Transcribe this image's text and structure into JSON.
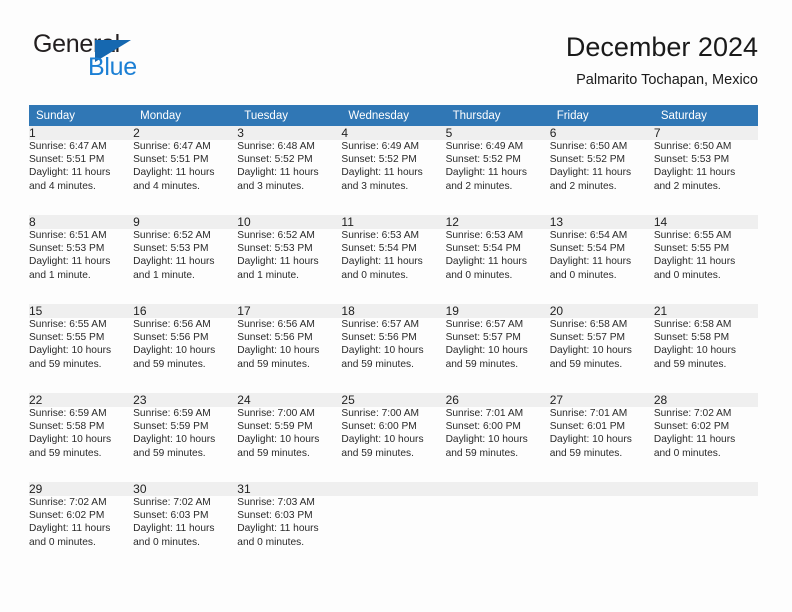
{
  "logo": {
    "word_dark": "General",
    "word_blue": "Blue",
    "triangle_color": "#1668b0",
    "blue_color": "#1b7fd4"
  },
  "header": {
    "title": "December 2024",
    "subtitle": "Palmarito Tochapan, Mexico"
  },
  "theme": {
    "header_blue": "#3077b5",
    "separator_blue": "#1a6cae",
    "daynum_bg": "#efefef",
    "page_bg": "#fdfdfd"
  },
  "calendar": {
    "weekday_headers": [
      "Sunday",
      "Monday",
      "Tuesday",
      "Wednesday",
      "Thursday",
      "Friday",
      "Saturday"
    ],
    "labels": {
      "sunrise": "Sunrise:",
      "sunset": "Sunset:",
      "daylight": "Daylight:"
    },
    "weeks": [
      [
        {
          "day": "1",
          "sunrise": "Sunrise: 6:47 AM",
          "sunset": "Sunset: 5:51 PM",
          "daylight_1": "Daylight: 11 hours",
          "daylight_2": "and 4 minutes."
        },
        {
          "day": "2",
          "sunrise": "Sunrise: 6:47 AM",
          "sunset": "Sunset: 5:51 PM",
          "daylight_1": "Daylight: 11 hours",
          "daylight_2": "and 4 minutes."
        },
        {
          "day": "3",
          "sunrise": "Sunrise: 6:48 AM",
          "sunset": "Sunset: 5:52 PM",
          "daylight_1": "Daylight: 11 hours",
          "daylight_2": "and 3 minutes."
        },
        {
          "day": "4",
          "sunrise": "Sunrise: 6:49 AM",
          "sunset": "Sunset: 5:52 PM",
          "daylight_1": "Daylight: 11 hours",
          "daylight_2": "and 3 minutes."
        },
        {
          "day": "5",
          "sunrise": "Sunrise: 6:49 AM",
          "sunset": "Sunset: 5:52 PM",
          "daylight_1": "Daylight: 11 hours",
          "daylight_2": "and 2 minutes."
        },
        {
          "day": "6",
          "sunrise": "Sunrise: 6:50 AM",
          "sunset": "Sunset: 5:52 PM",
          "daylight_1": "Daylight: 11 hours",
          "daylight_2": "and 2 minutes."
        },
        {
          "day": "7",
          "sunrise": "Sunrise: 6:50 AM",
          "sunset": "Sunset: 5:53 PM",
          "daylight_1": "Daylight: 11 hours",
          "daylight_2": "and 2 minutes."
        }
      ],
      [
        {
          "day": "8",
          "sunrise": "Sunrise: 6:51 AM",
          "sunset": "Sunset: 5:53 PM",
          "daylight_1": "Daylight: 11 hours",
          "daylight_2": "and 1 minute."
        },
        {
          "day": "9",
          "sunrise": "Sunrise: 6:52 AM",
          "sunset": "Sunset: 5:53 PM",
          "daylight_1": "Daylight: 11 hours",
          "daylight_2": "and 1 minute."
        },
        {
          "day": "10",
          "sunrise": "Sunrise: 6:52 AM",
          "sunset": "Sunset: 5:53 PM",
          "daylight_1": "Daylight: 11 hours",
          "daylight_2": "and 1 minute."
        },
        {
          "day": "11",
          "sunrise": "Sunrise: 6:53 AM",
          "sunset": "Sunset: 5:54 PM",
          "daylight_1": "Daylight: 11 hours",
          "daylight_2": "and 0 minutes."
        },
        {
          "day": "12",
          "sunrise": "Sunrise: 6:53 AM",
          "sunset": "Sunset: 5:54 PM",
          "daylight_1": "Daylight: 11 hours",
          "daylight_2": "and 0 minutes."
        },
        {
          "day": "13",
          "sunrise": "Sunrise: 6:54 AM",
          "sunset": "Sunset: 5:54 PM",
          "daylight_1": "Daylight: 11 hours",
          "daylight_2": "and 0 minutes."
        },
        {
          "day": "14",
          "sunrise": "Sunrise: 6:55 AM",
          "sunset": "Sunset: 5:55 PM",
          "daylight_1": "Daylight: 11 hours",
          "daylight_2": "and 0 minutes."
        }
      ],
      [
        {
          "day": "15",
          "sunrise": "Sunrise: 6:55 AM",
          "sunset": "Sunset: 5:55 PM",
          "daylight_1": "Daylight: 10 hours",
          "daylight_2": "and 59 minutes."
        },
        {
          "day": "16",
          "sunrise": "Sunrise: 6:56 AM",
          "sunset": "Sunset: 5:56 PM",
          "daylight_1": "Daylight: 10 hours",
          "daylight_2": "and 59 minutes."
        },
        {
          "day": "17",
          "sunrise": "Sunrise: 6:56 AM",
          "sunset": "Sunset: 5:56 PM",
          "daylight_1": "Daylight: 10 hours",
          "daylight_2": "and 59 minutes."
        },
        {
          "day": "18",
          "sunrise": "Sunrise: 6:57 AM",
          "sunset": "Sunset: 5:56 PM",
          "daylight_1": "Daylight: 10 hours",
          "daylight_2": "and 59 minutes."
        },
        {
          "day": "19",
          "sunrise": "Sunrise: 6:57 AM",
          "sunset": "Sunset: 5:57 PM",
          "daylight_1": "Daylight: 10 hours",
          "daylight_2": "and 59 minutes."
        },
        {
          "day": "20",
          "sunrise": "Sunrise: 6:58 AM",
          "sunset": "Sunset: 5:57 PM",
          "daylight_1": "Daylight: 10 hours",
          "daylight_2": "and 59 minutes."
        },
        {
          "day": "21",
          "sunrise": "Sunrise: 6:58 AM",
          "sunset": "Sunset: 5:58 PM",
          "daylight_1": "Daylight: 10 hours",
          "daylight_2": "and 59 minutes."
        }
      ],
      [
        {
          "day": "22",
          "sunrise": "Sunrise: 6:59 AM",
          "sunset": "Sunset: 5:58 PM",
          "daylight_1": "Daylight: 10 hours",
          "daylight_2": "and 59 minutes."
        },
        {
          "day": "23",
          "sunrise": "Sunrise: 6:59 AM",
          "sunset": "Sunset: 5:59 PM",
          "daylight_1": "Daylight: 10 hours",
          "daylight_2": "and 59 minutes."
        },
        {
          "day": "24",
          "sunrise": "Sunrise: 7:00 AM",
          "sunset": "Sunset: 5:59 PM",
          "daylight_1": "Daylight: 10 hours",
          "daylight_2": "and 59 minutes."
        },
        {
          "day": "25",
          "sunrise": "Sunrise: 7:00 AM",
          "sunset": "Sunset: 6:00 PM",
          "daylight_1": "Daylight: 10 hours",
          "daylight_2": "and 59 minutes."
        },
        {
          "day": "26",
          "sunrise": "Sunrise: 7:01 AM",
          "sunset": "Sunset: 6:00 PM",
          "daylight_1": "Daylight: 10 hours",
          "daylight_2": "and 59 minutes."
        },
        {
          "day": "27",
          "sunrise": "Sunrise: 7:01 AM",
          "sunset": "Sunset: 6:01 PM",
          "daylight_1": "Daylight: 10 hours",
          "daylight_2": "and 59 minutes."
        },
        {
          "day": "28",
          "sunrise": "Sunrise: 7:02 AM",
          "sunset": "Sunset: 6:02 PM",
          "daylight_1": "Daylight: 11 hours",
          "daylight_2": "and 0 minutes."
        }
      ],
      [
        {
          "day": "29",
          "sunrise": "Sunrise: 7:02 AM",
          "sunset": "Sunset: 6:02 PM",
          "daylight_1": "Daylight: 11 hours",
          "daylight_2": "and 0 minutes."
        },
        {
          "day": "30",
          "sunrise": "Sunrise: 7:02 AM",
          "sunset": "Sunset: 6:03 PM",
          "daylight_1": "Daylight: 11 hours",
          "daylight_2": "and 0 minutes."
        },
        {
          "day": "31",
          "sunrise": "Sunrise: 7:03 AM",
          "sunset": "Sunset: 6:03 PM",
          "daylight_1": "Daylight: 11 hours",
          "daylight_2": "and 0 minutes."
        },
        {
          "day": "",
          "sunrise": "",
          "sunset": "",
          "daylight_1": "",
          "daylight_2": ""
        },
        {
          "day": "",
          "sunrise": "",
          "sunset": "",
          "daylight_1": "",
          "daylight_2": ""
        },
        {
          "day": "",
          "sunrise": "",
          "sunset": "",
          "daylight_1": "",
          "daylight_2": ""
        },
        {
          "day": "",
          "sunrise": "",
          "sunset": "",
          "daylight_1": "",
          "daylight_2": ""
        }
      ]
    ]
  }
}
